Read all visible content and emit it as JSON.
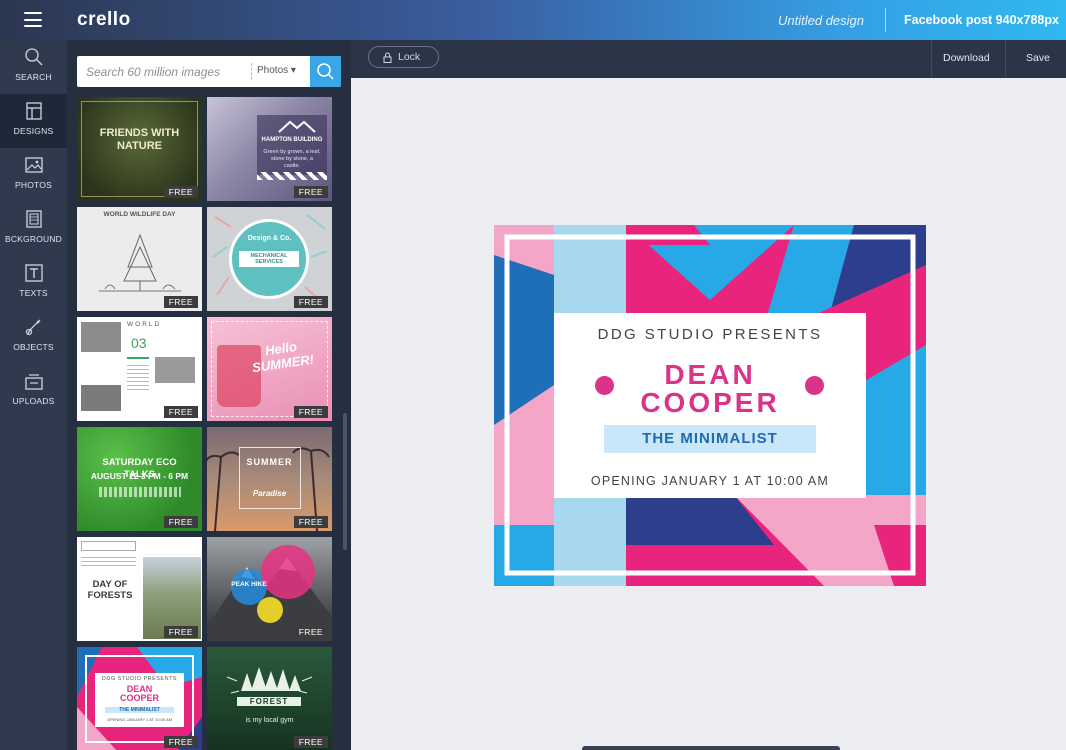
{
  "app": {
    "logo": "crello",
    "design_title": "Untitled design",
    "design_size": "Facebook post 940x788px"
  },
  "nav": [
    {
      "label": "SEARCH",
      "icon": "search-icon"
    },
    {
      "label": "DESIGNS",
      "icon": "designs-icon"
    },
    {
      "label": "PHOTOS",
      "icon": "photos-icon"
    },
    {
      "label": "BCKGROUND",
      "icon": "background-icon"
    },
    {
      "label": "TEXTS",
      "icon": "texts-icon"
    },
    {
      "label": "OBJECTS",
      "icon": "objects-icon"
    },
    {
      "label": "UPLOADS",
      "icon": "uploads-icon"
    }
  ],
  "search": {
    "placeholder": "Search 60 million images",
    "filter": "Photos ▾"
  },
  "templates": {
    "free_badge": "FREE",
    "t1": {
      "title": "FRIENDS WITH NATURE"
    },
    "t2": {
      "title": "HAMPTON BUILDING",
      "text": "Green by grown, a leaf, stone by stone, a castle."
    },
    "t3": {
      "title": "WORLD WILDLIFE DAY"
    },
    "t4": {
      "title": "Design & Co.",
      "subtitle": "MECHANICAL SERVICES"
    },
    "t5": {
      "title": "WORLD",
      "number": "03"
    },
    "t6": {
      "title": "Hello SUMMER!"
    },
    "t7": {
      "title": "SATURDAY ECO TALKS",
      "date": "AUGUST 22 3 PM - 6 PM"
    },
    "t8": {
      "title": "SUMMER",
      "subtitle": "Paradise"
    },
    "t9": {
      "title": "DAY OF FORESTS"
    },
    "t10": {
      "title": "PEAK HIKE"
    },
    "t11": {
      "presents": "DDG STUDIO PRESENTS",
      "name": "DEAN COOPER",
      "sub": "THE MINIMALIST",
      "opening": "OPENING JANUARY 1 AT 10:00 AM"
    },
    "t12": {
      "title": "FOREST",
      "subtitle": "is my local gym"
    }
  },
  "toolbar": {
    "lock": "Lock",
    "download": "Download",
    "save": "Save"
  },
  "design": {
    "presents": "DDG STUDIO PRESENTS",
    "name_line1": "DEAN",
    "name_line2": "COOPER",
    "subtitle": "THE MINIMALIST",
    "opening": "OPENING JANUARY 1 AT 10:00 AM",
    "colors": {
      "pink": "#e8247c",
      "light_pink": "#f3a6c8",
      "blue": "#1f6fb8",
      "light_blue": "#a8d8f0",
      "cyan": "#27a9e8",
      "navy": "#2d3e8c"
    }
  }
}
